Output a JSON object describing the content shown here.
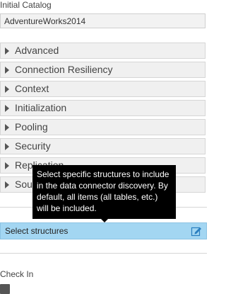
{
  "initial_catalog": {
    "label": "Initial Catalog",
    "value": "AdventureWorks2014"
  },
  "sections": [
    {
      "label": "Advanced"
    },
    {
      "label": "Connection Resiliency"
    },
    {
      "label": "Context"
    },
    {
      "label": "Initialization"
    },
    {
      "label": "Pooling"
    },
    {
      "label": "Security"
    },
    {
      "label": "Replication"
    },
    {
      "label": "Source"
    }
  ],
  "tooltip": {
    "text": "Select specific structures to include in the data connector discovery. By default, all items (all tables, etc.) will be included."
  },
  "select_structures": {
    "label": "Select structures",
    "icon": "edit-icon"
  },
  "check_in": {
    "label": "Check In"
  },
  "colors": {
    "select_bar": "#a3d6f2",
    "tooltip_bg": "#000000",
    "section_bg": "#f0f0f0"
  }
}
